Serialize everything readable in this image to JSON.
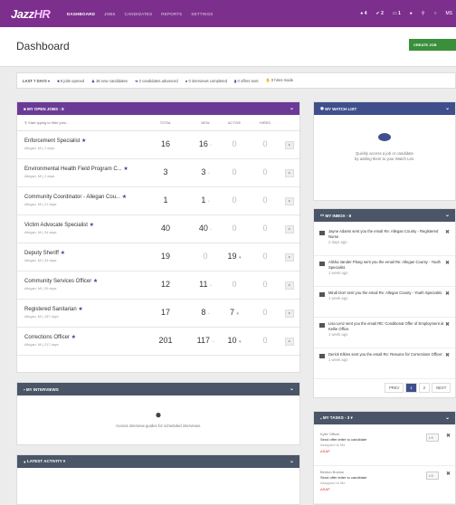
{
  "nav": {
    "logo_main": "Jazz",
    "logo_hr": "HR",
    "links": [
      "DASHBOARD",
      "JOBS",
      "CANDIDATES",
      "REPORTS",
      "SETTINGS"
    ],
    "right": {
      "count1": "4",
      "count2": "2",
      "count3": "1",
      "initials": "MS"
    }
  },
  "page": {
    "title": "Dashboard",
    "create_job": "CREATE JOB"
  },
  "summary": {
    "period": "LAST 7 DAYS ▾",
    "stats": [
      "8 jobs opened",
      "36 new candidates",
      "2 candidates advanced",
      "0 interviews completed",
      "0 offers sent",
      "0 hires made"
    ]
  },
  "jobs_panel": {
    "title": "MY OPEN JOBS - 8",
    "search_placeholder": "Start typing to filter jobs...",
    "columns": [
      "TOTAL",
      "NEW",
      "ACTIVE",
      "HIRED"
    ],
    "rows": [
      {
        "title": "Enforcement Specialist",
        "loc": "Allegan, MI | 2 days",
        "total": "16",
        "new": "16",
        "active": "0",
        "hired": "0"
      },
      {
        "title": "Environmental Health Field Program C...",
        "loc": "Allegan, MI | 2 days",
        "total": "3",
        "new": "3",
        "active": "0",
        "hired": "0"
      },
      {
        "title": "Community Coordinator - Allegan Cou...",
        "loc": "Allegan, MI | 21 days",
        "total": "1",
        "new": "1",
        "active": "0",
        "hired": "0"
      },
      {
        "title": "Victim Advocate Specialist",
        "loc": "Allegan, MI | 34 days",
        "total": "40",
        "new": "40",
        "active": "0",
        "hired": "0"
      },
      {
        "title": "Deputy Sheriff",
        "loc": "Allegan, MI | 34 days",
        "total": "19",
        "new": "0",
        "active": "19",
        "hired": "0"
      },
      {
        "title": "Community Services Officer",
        "loc": "Allegan, MI | 35 days",
        "total": "12",
        "new": "11",
        "active": "0",
        "hired": "0"
      },
      {
        "title": "Registered Sanitarian",
        "loc": "Allegan, MI | 187 days",
        "total": "17",
        "new": "8",
        "active": "7",
        "hired": "0"
      },
      {
        "title": "Corrections Officer",
        "loc": "Allegan, MI | 217 days",
        "total": "201",
        "new": "117",
        "active": "10",
        "hired": "0"
      }
    ]
  },
  "interviews_panel": {
    "title": "MY INTERVIEWS",
    "empty_text": "Access interview guides for scheduled interviews."
  },
  "activity_panel": {
    "title": "LATEST ACTIVITY ▾"
  },
  "watch_panel": {
    "title": "MY WATCH LIST",
    "empty_text_1": "Quickly access a job or candidate",
    "empty_text_2": "by adding them to your Watch List."
  },
  "inbox_panel": {
    "title": "MY INBOX - 8",
    "messages": [
      {
        "text": "Jayne Adams sent you the email Re: Allegan County - Registered Nurse",
        "time": "2 days ago"
      },
      {
        "text": "Alisha Vander Ploeg sent you the email Re: Allegan County - Youth Specialist.",
        "time": "1 week ago"
      },
      {
        "text": "Mindi Dorr sent you the email Re: Allegan County - Youth Specialist.",
        "time": "1 week ago"
      },
      {
        "text": "Lisa Lenz sent you the email RE: Conditional Offer of Employment at Kellie Office.",
        "time": "1 week ago"
      },
      {
        "text": "Derick Elkins sent you the email Re: Resume for Corrections Officer.",
        "time": "1 week ago"
      }
    ],
    "pager": [
      "PREV",
      "1",
      "2",
      "NEXT"
    ]
  },
  "tasks_panel": {
    "title": "MY TASKS - 3 ▾",
    "tasks": [
      {
        "name": "Kylie Officer",
        "task": "Send offer letter to candidate",
        "assigned": "Assigned to Me",
        "priority": "ASAP",
        "select": "LS"
      },
      {
        "name": "Benton Buxton",
        "task": "Send offer letter to candidate",
        "assigned": "Assigned to Me",
        "priority": "ASAP",
        "select": "LS"
      }
    ]
  },
  "colors": {
    "nav": "#7d2f8e",
    "jobs_header": "#6b3a96",
    "panel_blue": "#3f4f8c",
    "panel_dark": "#4a5568",
    "create_green": "#3a8f3a"
  }
}
